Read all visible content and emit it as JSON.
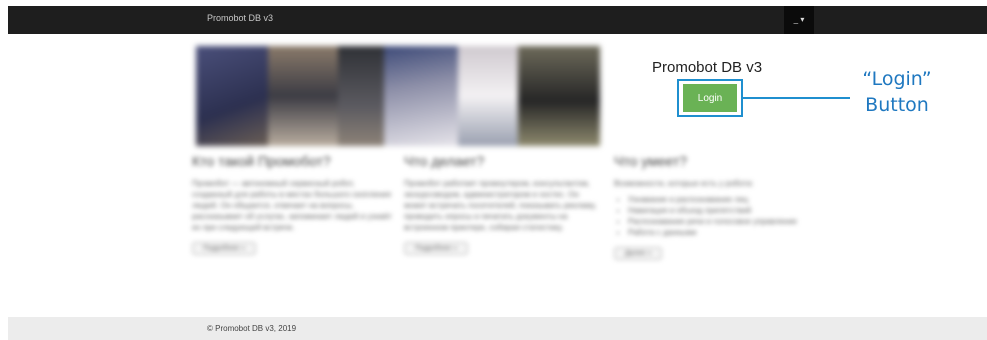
{
  "navbar": {
    "brand": "Promobot DB v3",
    "menu_label": "_ ▾"
  },
  "hero": {
    "image": "blurred-photo-collage"
  },
  "main": {
    "title": "Promobot DB v3",
    "login_label": "Login"
  },
  "annotation": {
    "line1": "“Login”",
    "line2": "Button",
    "color": "#1f8fcf"
  },
  "columns": [
    {
      "heading": "Кто такой Промобот?",
      "text": "Промобот — автономный сервисный робот, созданный для работы в местах большого скопления людей. Он общается, отвечает на вопросы, рассказывает об услугах, запоминает людей и узнаёт их при следующей встрече.",
      "button": "Подробнее »"
    },
    {
      "heading": "Что делает?",
      "text": "Промобот работает промоутером, консультантом, экскурсоводом, администратором и хостес. Он может встречать посетителей, показывать рекламу, проводить опросы и печатать документы на встроенном принтере, собирая статистику.",
      "button": "Подробнее »"
    },
    {
      "heading": "Что умеет?",
      "text": "Возможности, которые есть у робота:",
      "items": [
        "Узнавание и распознавание лиц",
        "Навигация и объезд препятствий",
        "Распознавание речи и голосовое управление",
        "Работа с данными"
      ],
      "button": "Далее »"
    }
  ],
  "footer": {
    "text": "© Promobot DB v3, 2019"
  }
}
